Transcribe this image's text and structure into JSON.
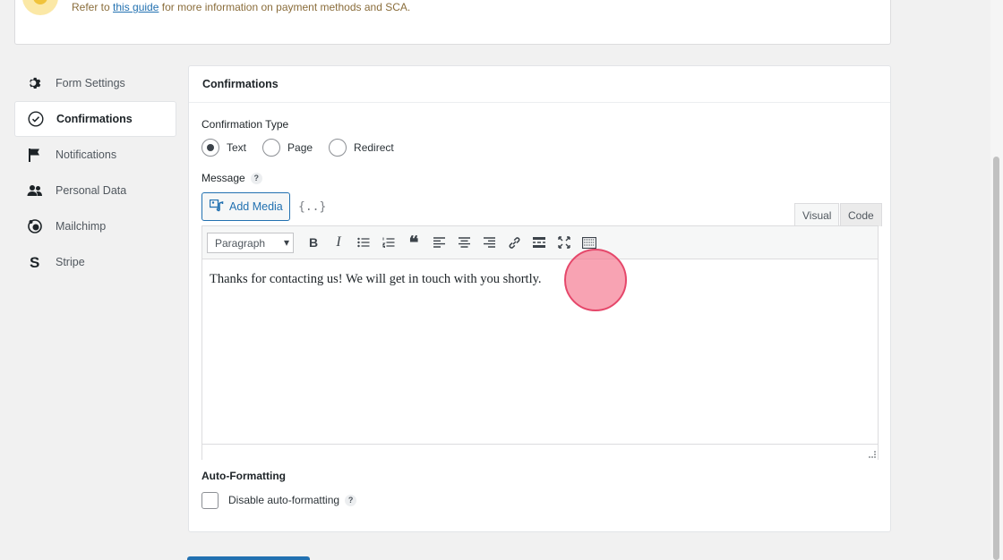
{
  "notice": {
    "prefix": "Refer to",
    "link": "this guide",
    "suffix": "for more information on payment methods and SCA."
  },
  "sidebar": {
    "items": [
      {
        "label": "Form Settings",
        "icon": "gear-icon"
      },
      {
        "label": "Confirmations",
        "icon": "check-circle-icon",
        "active": true
      },
      {
        "label": "Notifications",
        "icon": "flag-icon"
      },
      {
        "label": "Personal Data",
        "icon": "users-icon"
      },
      {
        "label": "Mailchimp",
        "icon": "mailchimp-icon"
      },
      {
        "label": "Stripe",
        "icon": "stripe-icon"
      }
    ]
  },
  "panel": {
    "title": "Confirmations",
    "confirmation_type_label": "Confirmation Type",
    "options": [
      {
        "label": "Text",
        "checked": true
      },
      {
        "label": "Page",
        "checked": false
      },
      {
        "label": "Redirect",
        "checked": false
      }
    ],
    "message_label": "Message",
    "help": "?",
    "add_media": "Add Media",
    "merge_tag": "{..}",
    "tabs": {
      "visual": "Visual",
      "code": "Code"
    },
    "toolbar": {
      "format": "Paragraph"
    },
    "message_text": "Thanks for contacting us! We will get in touch with you shortly.",
    "auto_formatting_label": "Auto-Formatting",
    "disable_auto_formatting": "Disable auto-formatting"
  },
  "colors": {
    "accent": "#2271b1",
    "click_marker": "#f4728b"
  }
}
